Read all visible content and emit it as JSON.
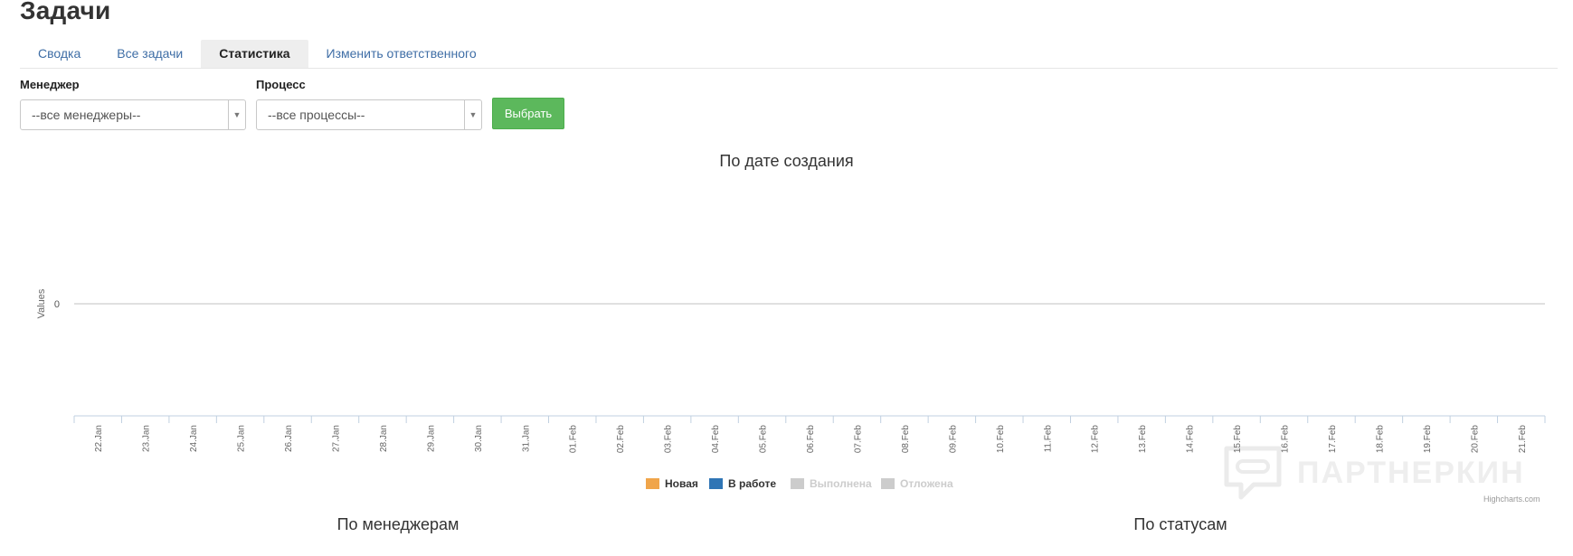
{
  "page": {
    "title": "Задачи"
  },
  "tabs": [
    {
      "label": "Сводка",
      "active": false
    },
    {
      "label": "Все задачи",
      "active": false
    },
    {
      "label": "Статистика",
      "active": true
    },
    {
      "label": "Изменить ответственного",
      "active": false
    }
  ],
  "filters": {
    "manager": {
      "label": "Менеджер",
      "value": "--все менеджеры--"
    },
    "process": {
      "label": "Процесс",
      "value": "--все процессы--"
    },
    "submit_label": "Выбрать"
  },
  "chart_data": [
    {
      "type": "line",
      "title": "По дате создания",
      "ylabel": "Values",
      "xlabel": "",
      "categories": [
        "22.Jan",
        "23.Jan",
        "24.Jan",
        "25.Jan",
        "26.Jan",
        "27.Jan",
        "28.Jan",
        "29.Jan",
        "30.Jan",
        "31.Jan",
        "01.Feb",
        "02.Feb",
        "03.Feb",
        "04.Feb",
        "05.Feb",
        "06.Feb",
        "07.Feb",
        "08.Feb",
        "09.Feb",
        "10.Feb",
        "11.Feb",
        "12.Feb",
        "13.Feb",
        "14.Feb",
        "15.Feb",
        "16.Feb",
        "17.Feb",
        "18.Feb",
        "19.Feb",
        "20.Feb",
        "21.Feb"
      ],
      "y_ticks": [
        0
      ],
      "series": [
        {
          "name": "Новая",
          "color": "#f0a54a",
          "visible": true,
          "values": []
        },
        {
          "name": "В работе",
          "color": "#2f75b5",
          "visible": true,
          "values": []
        },
        {
          "name": "Выполнена",
          "color": "#cccccc",
          "visible": false,
          "values": []
        },
        {
          "name": "Отложена",
          "color": "#cccccc",
          "visible": false,
          "values": []
        }
      ],
      "legend_position": "bottom-center",
      "credits": "Highcharts.com"
    },
    {
      "type": "pie",
      "title": "По менеджерам"
    },
    {
      "type": "pie",
      "title": "По статусам"
    }
  ],
  "watermark": {
    "text": "ПАРТНЕРКИН"
  },
  "colors": {
    "accent": "#3f6ea6",
    "button": "#5cb85c",
    "hidden_series": "#cccccc"
  }
}
